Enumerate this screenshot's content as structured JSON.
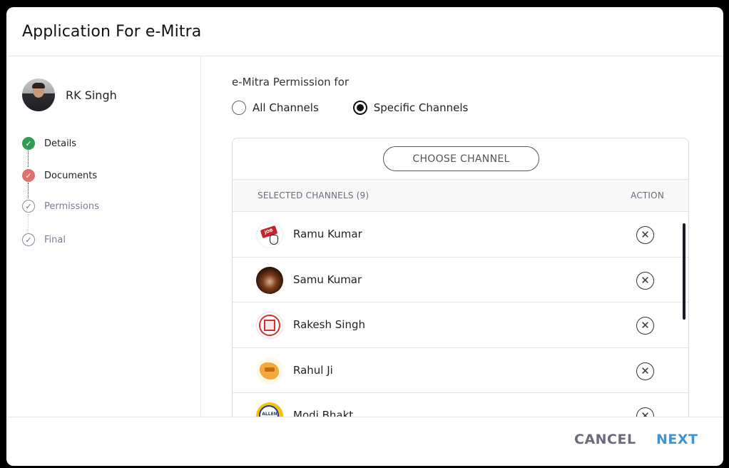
{
  "modal": {
    "title": "Application For e-Mitra"
  },
  "user": {
    "name": "RK Singh"
  },
  "steps": [
    {
      "label": "Details",
      "status": "done"
    },
    {
      "label": "Documents",
      "status": "error"
    },
    {
      "label": "Permissions",
      "status": "pending"
    },
    {
      "label": "Final",
      "status": "pending"
    }
  ],
  "permission": {
    "title": "e-Mitra Permission for",
    "options": [
      {
        "label": "All Channels",
        "checked": false
      },
      {
        "label": "Specific Channels",
        "checked": true
      }
    ]
  },
  "channels": {
    "choose_label": "CHOOSE CHANNEL",
    "header_name": "SELECTED CHANNELS (9)",
    "header_action": "ACTION",
    "rows": [
      {
        "name": "Ramu Kumar"
      },
      {
        "name": "Samu Kumar"
      },
      {
        "name": "Rakesh Singh"
      },
      {
        "name": "Rahul Ji"
      },
      {
        "name": "Modi Bhakt"
      }
    ]
  },
  "footer": {
    "cancel_label": "CANCEL",
    "next_label": "NEXT"
  },
  "icons": {
    "check": "✓",
    "remove": "✕"
  },
  "colors": {
    "done": "#2e9e55",
    "error": "#e07070",
    "primary": "#3d95d6"
  }
}
